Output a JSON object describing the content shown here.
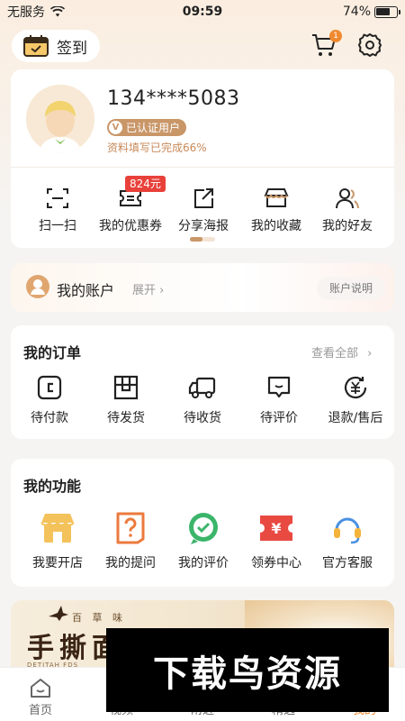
{
  "status_bar": {
    "carrier": "无服务",
    "time": "09:59",
    "battery": "74%",
    "battery_level": 0.74
  },
  "header": {
    "signin_label": "签到",
    "cart_badge": "1"
  },
  "profile": {
    "phone": "134****5083",
    "verified_label": "已认证用户",
    "completion_text": "资料填写已完成66%",
    "coupon_badge": "824元",
    "quick_actions": [
      "扫一扫",
      "我的优惠券",
      "分享海报",
      "我的收藏",
      "我的好友"
    ]
  },
  "account": {
    "title": "我的账户",
    "expand": "展开",
    "help": "账户说明"
  },
  "orders": {
    "title": "我的订单",
    "view_all": "查看全部",
    "items": [
      "待付款",
      "待发货",
      "待收货",
      "待评价",
      "退款/售后"
    ]
  },
  "functions": {
    "title": "我的功能",
    "items": [
      "我要开店",
      "我的提问",
      "我的评价",
      "领券中心",
      "官方客服"
    ]
  },
  "banner": {
    "sub": "百 草 味",
    "headline": "手撕面",
    "tiny": "DETITAH FDS"
  },
  "tabbar": {
    "items": [
      "首页",
      "视频",
      "附近",
      "精选",
      "我的"
    ],
    "active_index": 4
  },
  "watermark": "下载鸟资源",
  "colors": {
    "accent": "#c99668",
    "orange": "#f08a30",
    "badge_red": "#e8413a"
  }
}
